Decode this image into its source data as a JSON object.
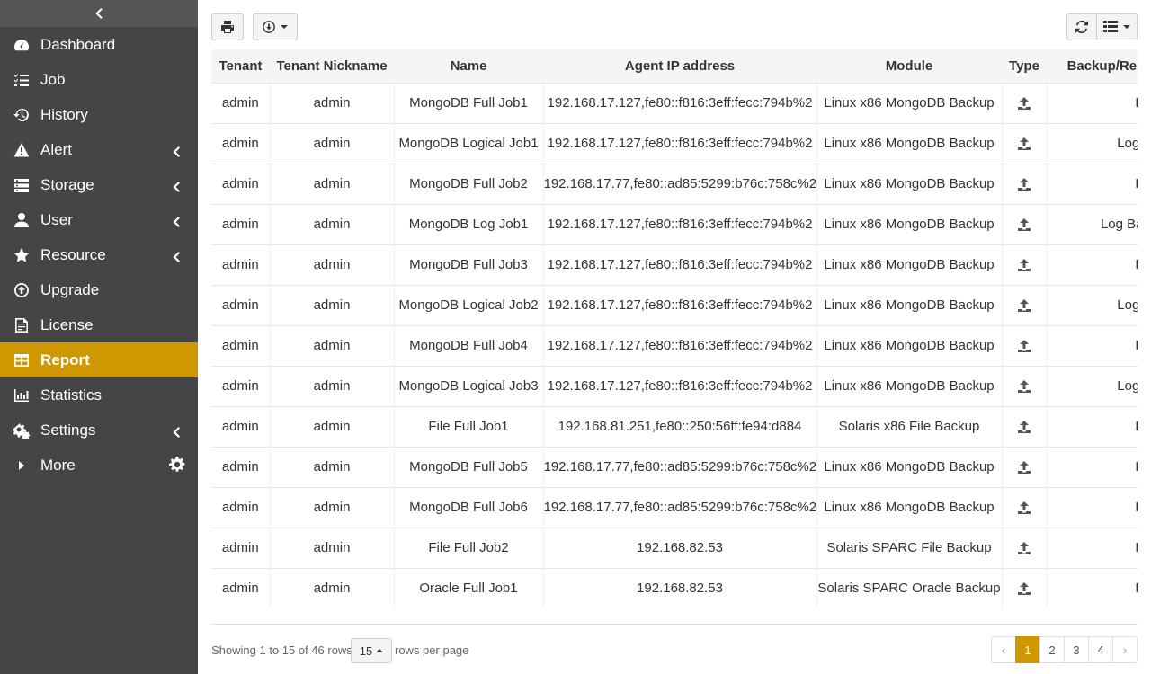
{
  "sidebar": {
    "items": [
      {
        "label": "Dashboard",
        "icon": "dashboard-icon",
        "submenu": false
      },
      {
        "label": "Job",
        "icon": "job-list-icon",
        "submenu": false
      },
      {
        "label": "History",
        "icon": "history-icon",
        "submenu": false
      },
      {
        "label": "Alert",
        "icon": "alert-icon",
        "submenu": true
      },
      {
        "label": "Storage",
        "icon": "storage-icon",
        "submenu": true
      },
      {
        "label": "User",
        "icon": "user-icon",
        "submenu": true
      },
      {
        "label": "Resource",
        "icon": "star-icon",
        "submenu": true
      },
      {
        "label": "Upgrade",
        "icon": "upgrade-icon",
        "submenu": false
      },
      {
        "label": "License",
        "icon": "license-icon",
        "submenu": false
      },
      {
        "label": "Report",
        "icon": "report-table-icon",
        "submenu": false,
        "active": true
      },
      {
        "label": "Statistics",
        "icon": "statistics-icon",
        "submenu": false
      },
      {
        "label": "Settings",
        "icon": "settings-icon",
        "submenu": true
      },
      {
        "label": "More",
        "icon": "caret-right-icon",
        "submenu": false
      }
    ]
  },
  "table": {
    "headers": [
      "Tenant",
      "Tenant Nickname",
      "Name",
      "Agent IP address",
      "Module",
      "Type",
      "Backup/Res"
    ],
    "rows": [
      [
        "admin",
        "admin",
        "MongoDB Full Job1",
        "192.168.17.127,fe80::f816:3eff:fecc:794b%2",
        "Linux x86 MongoDB Backup",
        "upload",
        "Full"
      ],
      [
        "admin",
        "admin",
        "MongoDB Logical Job1",
        "192.168.17.127,fe80::f816:3eff:fecc:794b%2",
        "Linux x86 MongoDB Backup",
        "upload",
        "Logica"
      ],
      [
        "admin",
        "admin",
        "MongoDB Full Job2",
        "192.168.17.77,fe80::ad85:5299:b76c:758c%2",
        "Linux x86 MongoDB Backup",
        "upload",
        "Full"
      ],
      [
        "admin",
        "admin",
        "MongoDB Log Job1",
        "192.168.17.127,fe80::f816:3eff:fecc:794b%2",
        "Linux x86 MongoDB Backup",
        "upload",
        "Log Back"
      ],
      [
        "admin",
        "admin",
        "MongoDB Full Job3",
        "192.168.17.127,fe80::f816:3eff:fecc:794b%2",
        "Linux x86 MongoDB Backup",
        "upload",
        "Full"
      ],
      [
        "admin",
        "admin",
        "MongoDB Logical Job2",
        "192.168.17.127,fe80::f816:3eff:fecc:794b%2",
        "Linux x86 MongoDB Backup",
        "upload",
        "Logica"
      ],
      [
        "admin",
        "admin",
        "MongoDB Full Job4",
        "192.168.17.127,fe80::f816:3eff:fecc:794b%2",
        "Linux x86 MongoDB Backup",
        "upload",
        "Full"
      ],
      [
        "admin",
        "admin",
        "MongoDB Logical Job3",
        "192.168.17.127,fe80::f816:3eff:fecc:794b%2",
        "Linux x86 MongoDB Backup",
        "upload",
        "Logica"
      ],
      [
        "admin",
        "admin",
        "File Full Job1",
        "192.168.81.251,fe80::250:56ff:fe94:d884",
        "Solaris x86 File Backup",
        "upload",
        "Full"
      ],
      [
        "admin",
        "admin",
        "MongoDB Full Job5",
        "192.168.17.77,fe80::ad85:5299:b76c:758c%2",
        "Linux x86 MongoDB Backup",
        "upload",
        "Full"
      ],
      [
        "admin",
        "admin",
        "MongoDB Full Job6",
        "192.168.17.77,fe80::ad85:5299:b76c:758c%2",
        "Linux x86 MongoDB Backup",
        "upload",
        "Full"
      ],
      [
        "admin",
        "admin",
        "File Full Job2",
        "192.168.82.53",
        "Solaris SPARC File Backup",
        "upload",
        "Full"
      ],
      [
        "admin",
        "admin",
        "Oracle Full Job1",
        "192.168.82.53",
        "Solaris SPARC Oracle Backup",
        "upload",
        "Full"
      ]
    ]
  },
  "footer": {
    "showing": "Showing 1 to 15 of 46 rows",
    "page_size": "15",
    "rows_per_page": "rows per page",
    "pages": [
      "‹",
      "1",
      "2",
      "3",
      "4",
      "›"
    ],
    "active_page": "1"
  },
  "colors": {
    "accent": "#cf9800",
    "sidebar": "#454545"
  }
}
